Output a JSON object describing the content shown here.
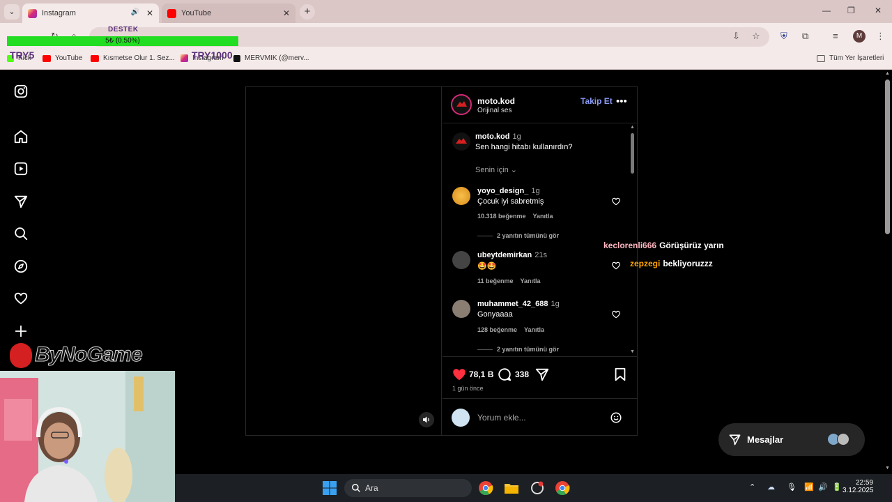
{
  "browser": {
    "tabs": [
      {
        "label": "Instagram",
        "active": true
      },
      {
        "label": "YouTube",
        "active": false
      }
    ],
    "bookmarks": [
      {
        "label": "Kick"
      },
      {
        "label": "YouTube"
      },
      {
        "label": "Kısmetse Olur 1. Sez..."
      },
      {
        "label": "Instagram"
      },
      {
        "label": "MERVMIK (@merv..."
      }
    ],
    "all_bookmarks_label": "Tüm Yer İşaretleri",
    "profile_initial": "M"
  },
  "overlay": {
    "destek_label": "DESTEK",
    "progress_text": "5₺ (0.50%)",
    "progress_fraction": 0.005,
    "goal_start": "TRY5",
    "goal_end": "TRY1000",
    "logo_text": "ByNoGame"
  },
  "post": {
    "author": "moto.kod",
    "audio": "Orijinal ses",
    "follow_label": "Takip Et",
    "more": "•••",
    "caption": {
      "user": "moto.kod",
      "time": "1g",
      "text": "Sen hangi hitabı kullanırdın?"
    },
    "sort_label": "Senin için",
    "comments": [
      {
        "user": "yoyo_design_",
        "time": "1g",
        "text": "Çocuk iyi sabretmiş",
        "likes": "10.318 beğenme",
        "reply": "Yanıtla",
        "replies": "2 yanıtın tümünü gör"
      },
      {
        "user": "ubeytdemirkan",
        "time": "21s",
        "text": "🤩🤩",
        "likes": "11 beğenme",
        "reply": "Yanıtla"
      },
      {
        "user": "muhammet_42_688",
        "time": "1g",
        "text": "Gonyaaaa",
        "likes": "128 beğenme",
        "reply": "Yanıtla",
        "replies": "2 yanıtın tümünü gör"
      }
    ],
    "like_count": "78,1 B",
    "comment_count": "338",
    "date": "1 gün önce",
    "add_comment_placeholder": "Yorum ekle..."
  },
  "chat": [
    {
      "user": "keclorenli666",
      "message": "Görüşürüz yarın"
    },
    {
      "user": "zepzegi",
      "message": "bekliyoruzzz"
    }
  ],
  "messages": {
    "label": "Mesajlar"
  },
  "taskbar": {
    "search_label": "Ara",
    "time": "22:59",
    "date": "3.12.2025"
  },
  "colors": {
    "follow": "#8c9bf5",
    "like": "#ff3040",
    "progress": "#22dd22"
  }
}
